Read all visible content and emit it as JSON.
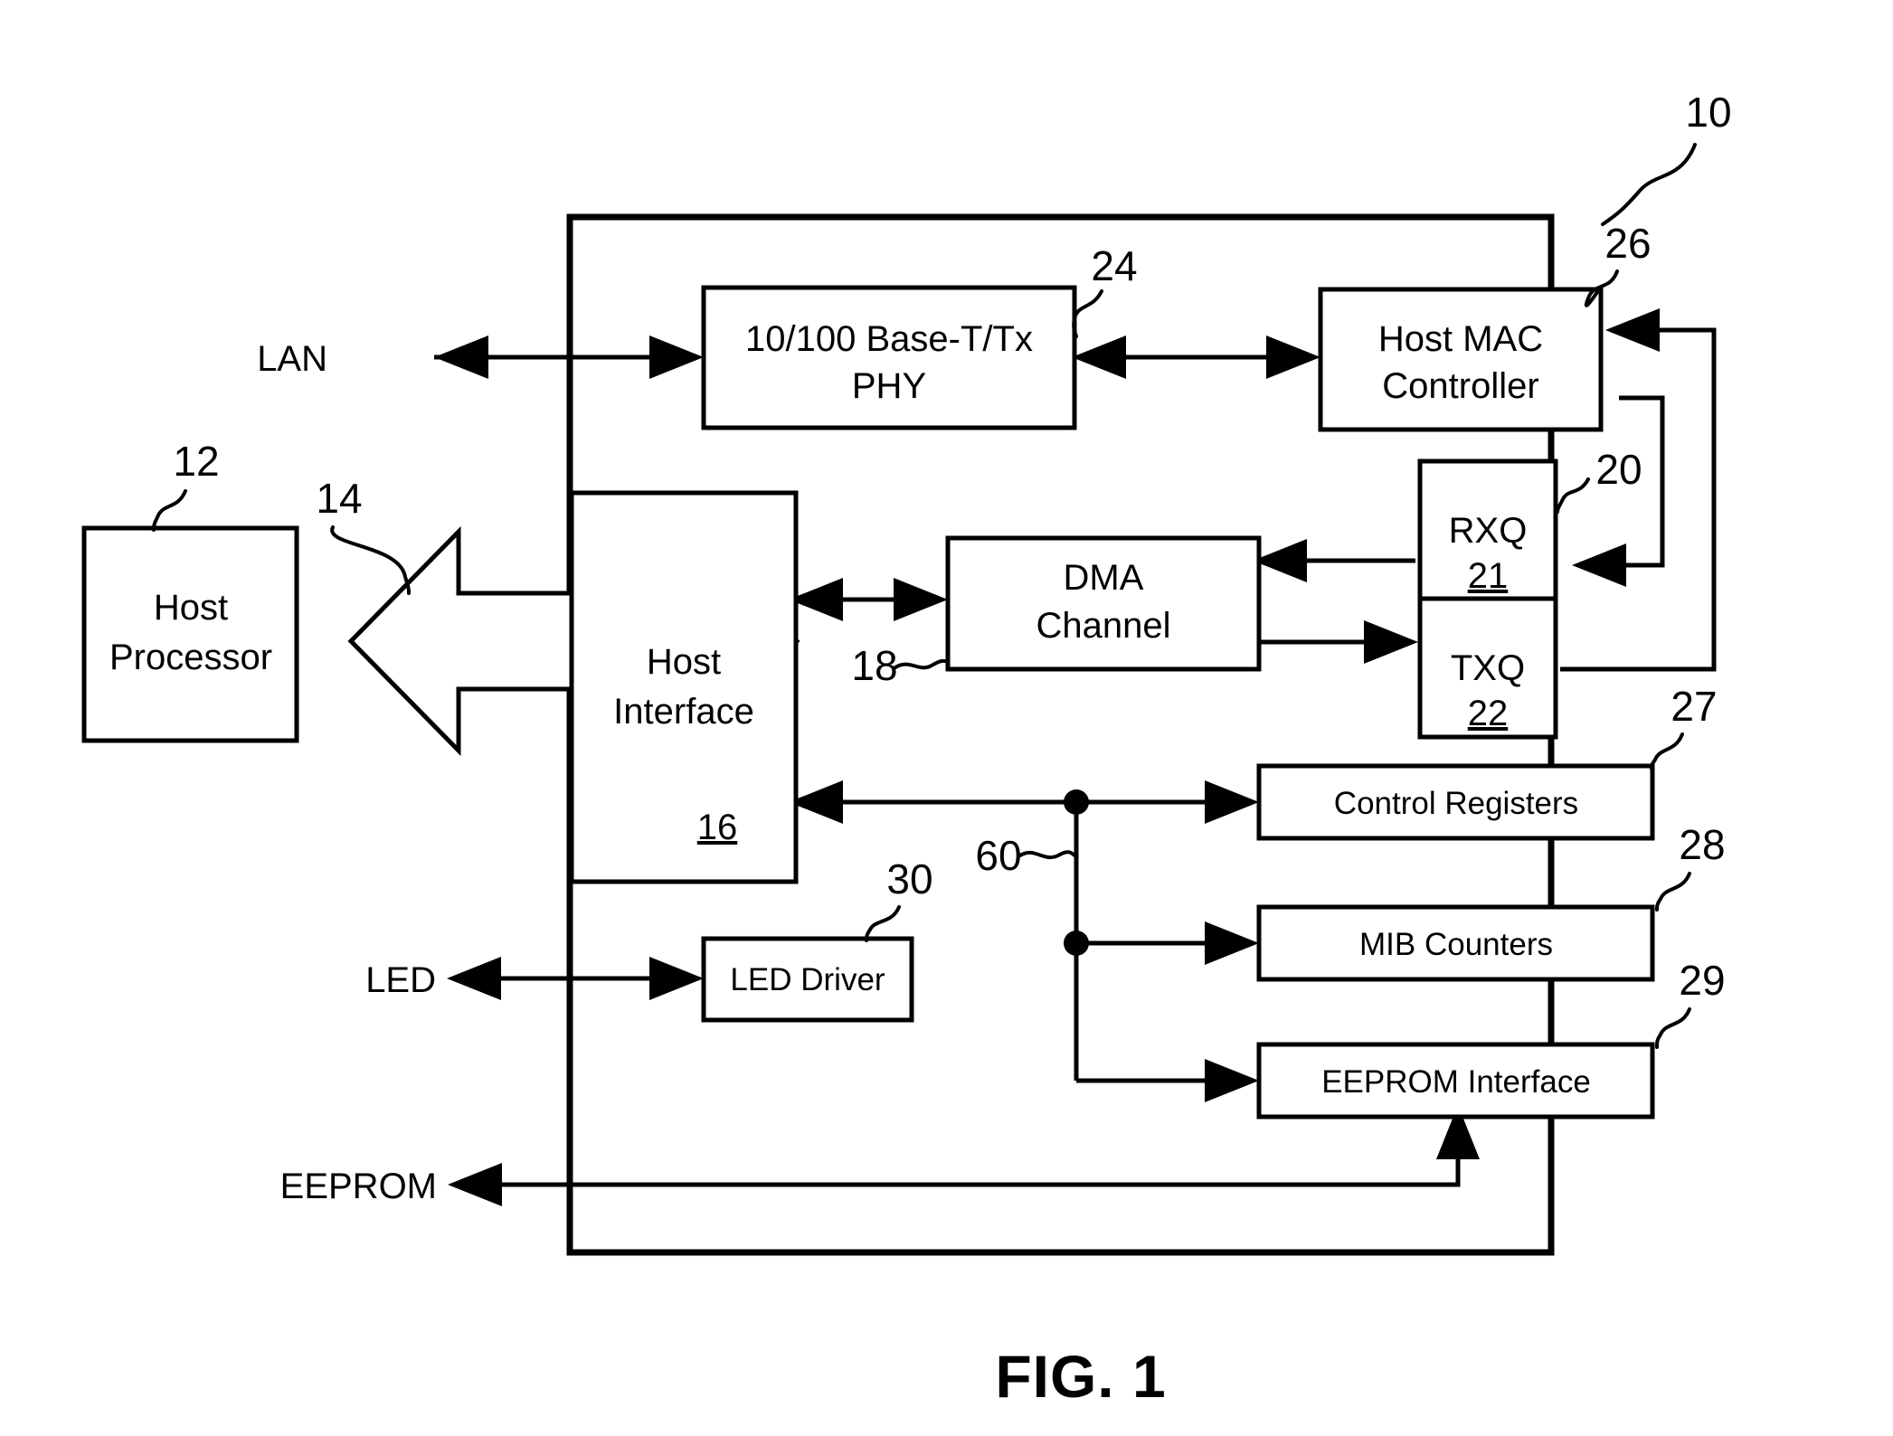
{
  "figure": {
    "caption": "FIG. 1",
    "chip_ref": "10"
  },
  "blocks": {
    "phy": {
      "line1": "10/100 Base-T/Tx",
      "line2": "PHY",
      "ref": "24"
    },
    "mac": {
      "line1": "Host MAC",
      "line2": "Controller",
      "ref": "26"
    },
    "queues": {
      "ref": "20"
    },
    "rxq": {
      "label": "RXQ",
      "num": "21"
    },
    "txq": {
      "label": "TXQ",
      "num": "22"
    },
    "dma": {
      "line1": "DMA",
      "line2": "Channel",
      "ref": "18"
    },
    "host_interface": {
      "line1": "Host",
      "line2": "Interface",
      "num": "16"
    },
    "host_processor": {
      "line1": "Host",
      "line2": "Processor",
      "ref": "12"
    },
    "host_bus": {
      "ref": "14"
    },
    "led_driver": {
      "label": "LED Driver",
      "ref": "30"
    },
    "control_registers": {
      "label": "Control Registers",
      "ref": "27"
    },
    "mib_counters": {
      "label": "MIB Counters",
      "ref": "28"
    },
    "eeprom_interface": {
      "label": "EEPROM Interface",
      "ref": "29"
    },
    "internal_bus": {
      "ref": "60"
    }
  },
  "ports": {
    "lan": "LAN",
    "led": "LED",
    "eeprom": "EEPROM"
  },
  "colors": {
    "ink": "#000000",
    "paper": "#ffffff"
  }
}
